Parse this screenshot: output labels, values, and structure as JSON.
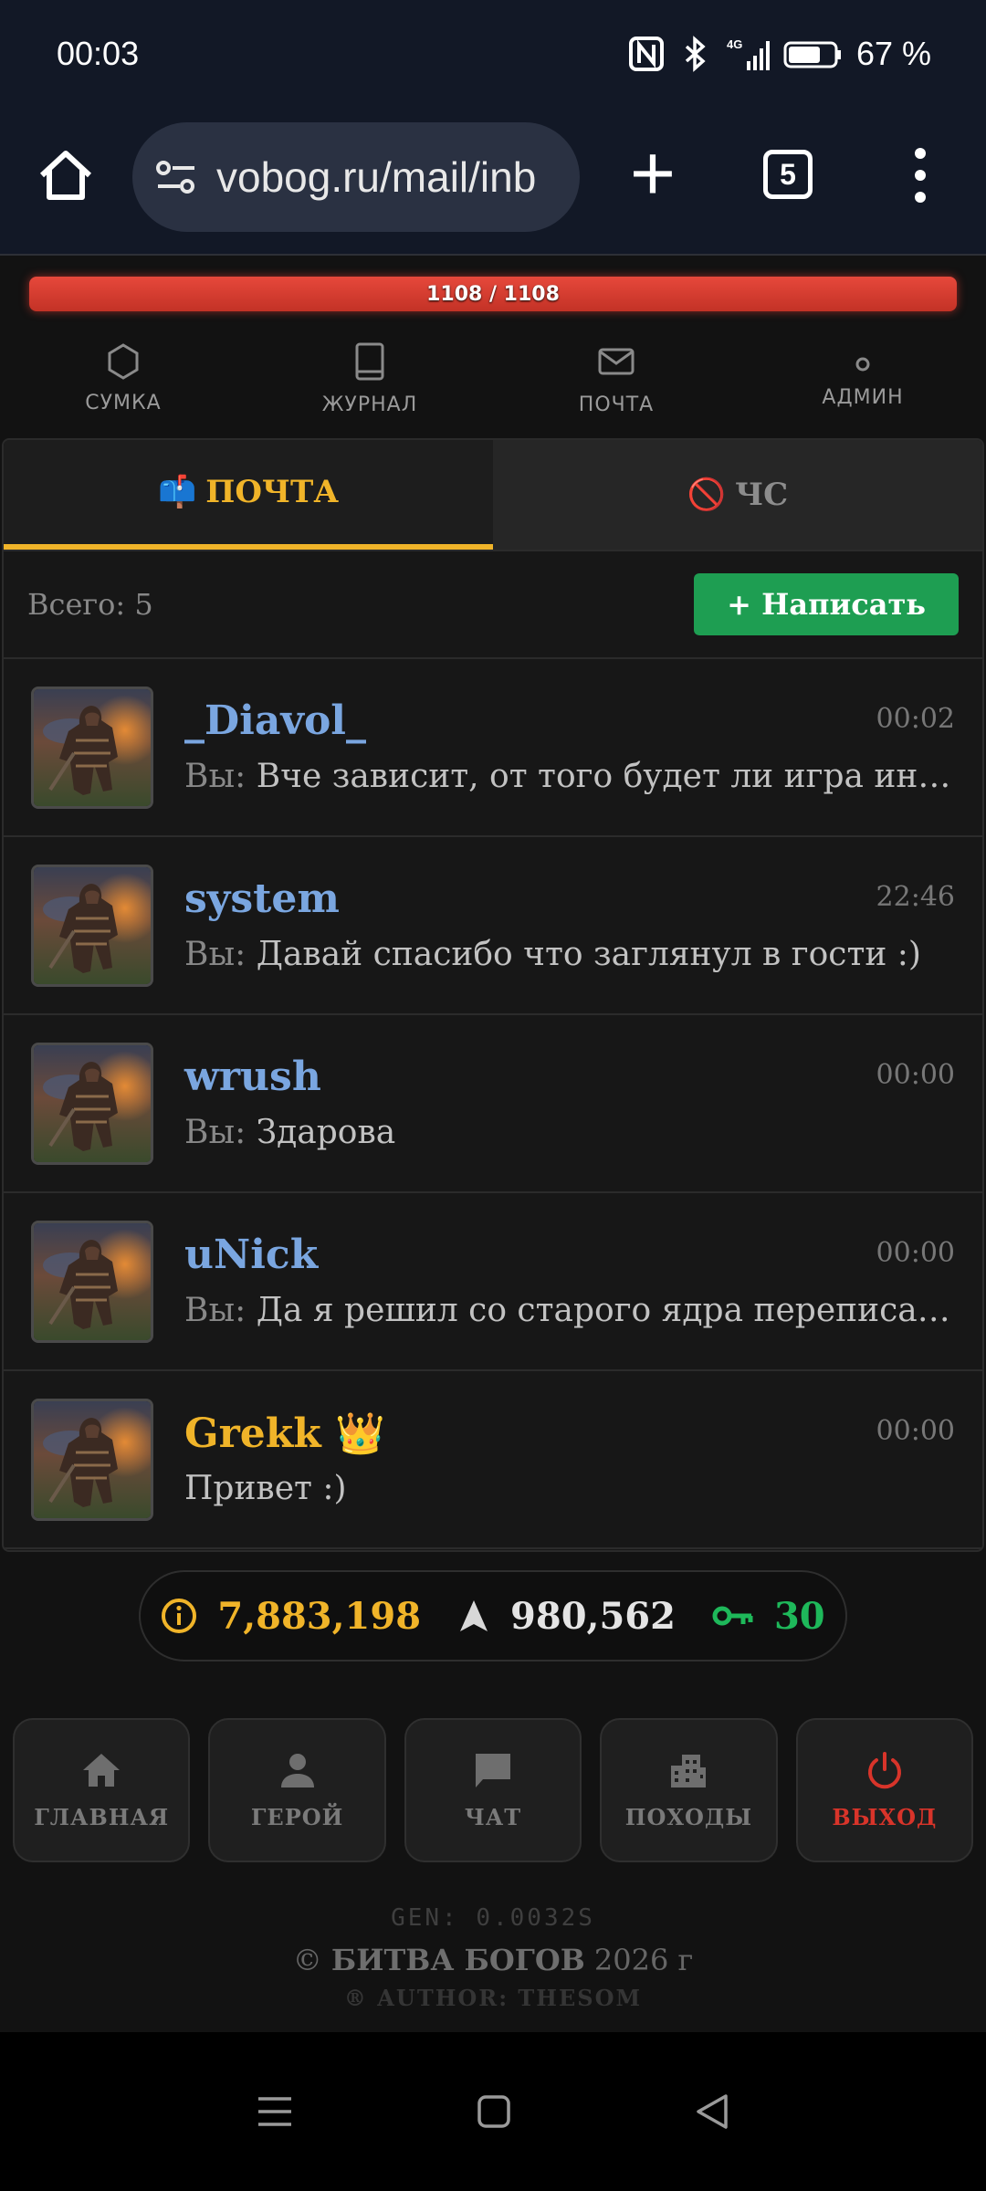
{
  "status_bar": {
    "time": "00:03",
    "network": "4G",
    "battery": "67 %"
  },
  "browser": {
    "url": "vobog.ru/mail/inb",
    "tab_count": "5"
  },
  "hp": {
    "text": "1108 / 1108",
    "fraction": 1.0
  },
  "top_nav": [
    {
      "label": "СУМКА",
      "icon": "hexagon-icon"
    },
    {
      "label": "ЖУРНАЛ",
      "icon": "book-icon"
    },
    {
      "label": "ПОЧТА",
      "icon": "mail-icon"
    },
    {
      "label": "АДМИН",
      "icon": "dot-icon"
    }
  ],
  "tabs": {
    "mail": "ПОЧТА",
    "mail_emoji": "📫",
    "blacklist": "ЧС",
    "blacklist_emoji": "🚫"
  },
  "toolbar": {
    "total": "Всего: 5",
    "compose": "+ Написать"
  },
  "messages": [
    {
      "name": "_Diavol_",
      "time": "00:02",
      "prefix": "Вы:",
      "text": "Вче зависит, от того будет ли игра интересной"
    },
    {
      "name": "system",
      "time": "22:46",
      "prefix": "Вы:",
      "text": "Давай спасибо что заглянул в гости :)"
    },
    {
      "name": "wrush",
      "time": "00:00",
      "prefix": "Вы:",
      "text": "Здарова"
    },
    {
      "name": "uNick",
      "time": "00:00",
      "prefix": "Вы:",
      "text": "Да я решил со старого ядра переписать :)"
    },
    {
      "name": "Grekk",
      "badge": "👑",
      "time": "00:00",
      "prefix": "",
      "text": "Привет :)"
    }
  ],
  "currency": {
    "gold": "7,883,198",
    "points": "980,562",
    "keys": "30"
  },
  "colors": {
    "gold": "#f0b429",
    "blue_name": "#7aa6e0",
    "green": "#1e9e52",
    "red": "#d8342a"
  },
  "bottom_nav": [
    {
      "label": "ГЛАВНАЯ",
      "icon": "home-icon"
    },
    {
      "label": "ГЕРОЙ",
      "icon": "person-icon"
    },
    {
      "label": "ЧАТ",
      "icon": "chat-icon"
    },
    {
      "label": "ПОХОДЫ",
      "icon": "city-icon"
    },
    {
      "label": "ВЫХОД",
      "icon": "power-icon"
    }
  ],
  "footer": {
    "gen": "GEN: 0.0032S",
    "copyright_prefix": "©",
    "game_name": "БИТВА БОГОВ",
    "year": "2026 г",
    "author": "® AUTHOR: THESOM"
  }
}
